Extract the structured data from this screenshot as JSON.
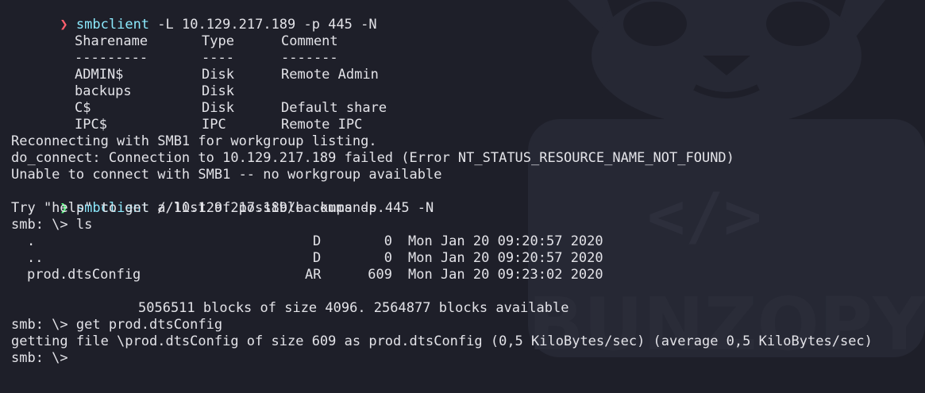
{
  "terminal": {
    "watermark_text": "BUNZOPY",
    "line1": {
      "arrow": "❯",
      "command": "smbclient",
      "args": " -L 10.129.217.189 -p 445 -N"
    },
    "share_header": {
      "name": "Sharename",
      "type": "Type",
      "comment": "Comment"
    },
    "share_sep": {
      "name": "---------",
      "type": "----",
      "comment": "-------"
    },
    "shares": [
      {
        "name": "ADMIN$",
        "type": "Disk",
        "comment": "Remote Admin"
      },
      {
        "name": "backups",
        "type": "Disk",
        "comment": ""
      },
      {
        "name": "C$",
        "type": "Disk",
        "comment": "Default share"
      },
      {
        "name": "IPC$",
        "type": "IPC",
        "comment": "Remote IPC"
      }
    ],
    "msg1": "Reconnecting with SMB1 for workgroup listing.",
    "msg2": "do_connect: Connection to 10.129.217.189 failed (Error NT_STATUS_RESOURCE_NAME_NOT_FOUND)",
    "msg3": "Unable to connect with SMB1 -- no workgroup available",
    "line2": {
      "arrow": "❯",
      "command": "smbclient",
      "args": " //10.129.217.189/backups -p 445 -N"
    },
    "help": "Try \"help\" to get a list of possible commands.",
    "smb_ls": "smb: \\> ls",
    "files": [
      {
        "name": ".",
        "attr": "D",
        "size": "0",
        "date": "Mon Jan 20 09:20:57 2020"
      },
      {
        "name": "..",
        "attr": "D",
        "size": "0",
        "date": "Mon Jan 20 09:20:57 2020"
      },
      {
        "name": "prod.dtsConfig",
        "attr": "AR",
        "size": "609",
        "date": "Mon Jan 20 09:23:02 2020"
      }
    ],
    "blocks": "5056511 blocks of size 4096. 2564877 blocks available",
    "smb_get": "smb: \\> get prod.dtsConfig",
    "getting": "getting file \\prod.dtsConfig of size 609 as prod.dtsConfig (0,5 KiloBytes/sec) (average 0,5 KiloBytes/sec)",
    "smb_prompt": "smb: \\>"
  }
}
